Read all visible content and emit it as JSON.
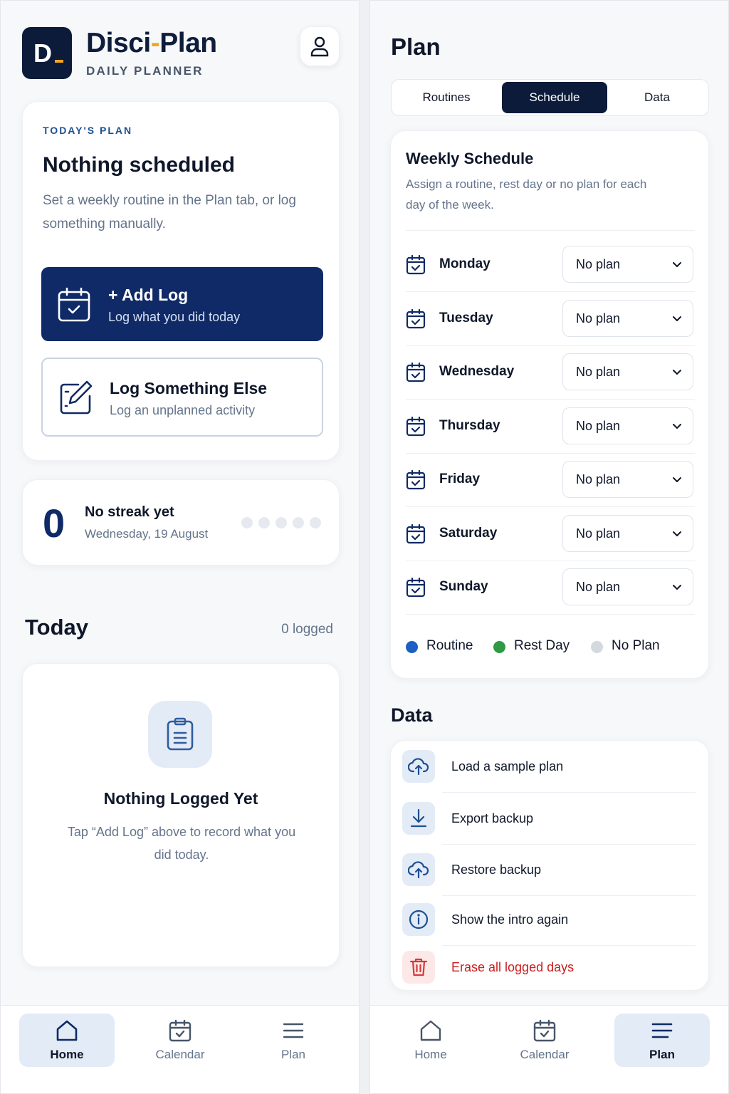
{
  "home": {
    "app": {
      "logo_letter": "D",
      "brand_prefix": "Disci",
      "brand_dash": "-",
      "brand_suffix": "Plan",
      "subtitle": "DAILY PLANNER"
    },
    "todays_plan": {
      "eyebrow": "TODAY'S PLAN",
      "title": "Nothing scheduled",
      "description": "Set a weekly routine in the Plan tab, or log something manually."
    },
    "add_log": {
      "title": "+ Add Log",
      "subtitle": "Log what you did today"
    },
    "log_else": {
      "title": "Log Something Else",
      "subtitle": "Log an unplanned activity"
    },
    "streak": {
      "count": "0",
      "title": "No streak yet",
      "date": "Wednesday, 19 August",
      "dots": 5
    },
    "today": {
      "heading": "Today",
      "count_label": "0 logged",
      "empty_title": "Nothing Logged Yet",
      "empty_desc": "Tap “Add Log” above to record what you did today."
    },
    "tabs": [
      {
        "label": "Home",
        "icon": "home-icon",
        "active": true
      },
      {
        "label": "Calendar",
        "icon": "calendar-icon",
        "active": false
      },
      {
        "label": "Plan",
        "icon": "menu-lines-icon",
        "active": false
      }
    ]
  },
  "plan": {
    "title": "Plan",
    "segments": [
      {
        "label": "Routines",
        "active": false
      },
      {
        "label": "Schedule",
        "active": true
      },
      {
        "label": "Data",
        "active": false
      }
    ],
    "weekly": {
      "title": "Weekly Schedule",
      "description": "Assign a routine, rest day or no plan for each day of the week.",
      "days": [
        {
          "name": "Monday",
          "value": "No plan"
        },
        {
          "name": "Tuesday",
          "value": "No plan"
        },
        {
          "name": "Wednesday",
          "value": "No plan"
        },
        {
          "name": "Thursday",
          "value": "No plan"
        },
        {
          "name": "Friday",
          "value": "No plan"
        },
        {
          "name": "Saturday",
          "value": "No plan"
        },
        {
          "name": "Sunday",
          "value": "No plan"
        }
      ],
      "legend": [
        {
          "label": "Routine",
          "color": "#1d5fc4"
        },
        {
          "label": "Rest Day",
          "color": "#2e9a46"
        },
        {
          "label": "No Plan",
          "color": "#d4d8df"
        }
      ]
    },
    "data_section": {
      "heading": "Data",
      "items": [
        {
          "label": "Load a sample plan",
          "icon": "cloud-upload-icon",
          "danger": false
        },
        {
          "label": "Export backup",
          "icon": "download-icon",
          "danger": false
        },
        {
          "label": "Restore backup",
          "icon": "cloud-upload-icon",
          "danger": false
        },
        {
          "label": "Show the intro again",
          "icon": "info-icon",
          "danger": false
        },
        {
          "label": "Erase all logged days",
          "icon": "trash-icon",
          "danger": true
        }
      ]
    },
    "tabs": [
      {
        "label": "Home",
        "icon": "home-icon",
        "active": false
      },
      {
        "label": "Calendar",
        "icon": "calendar-icon",
        "active": false
      },
      {
        "label": "Plan",
        "icon": "menu-lines-icon",
        "active": true
      }
    ]
  },
  "colors": {
    "navy": "#0f2a66",
    "accent": "#f2a71b",
    "danger": "#c81e1e"
  }
}
